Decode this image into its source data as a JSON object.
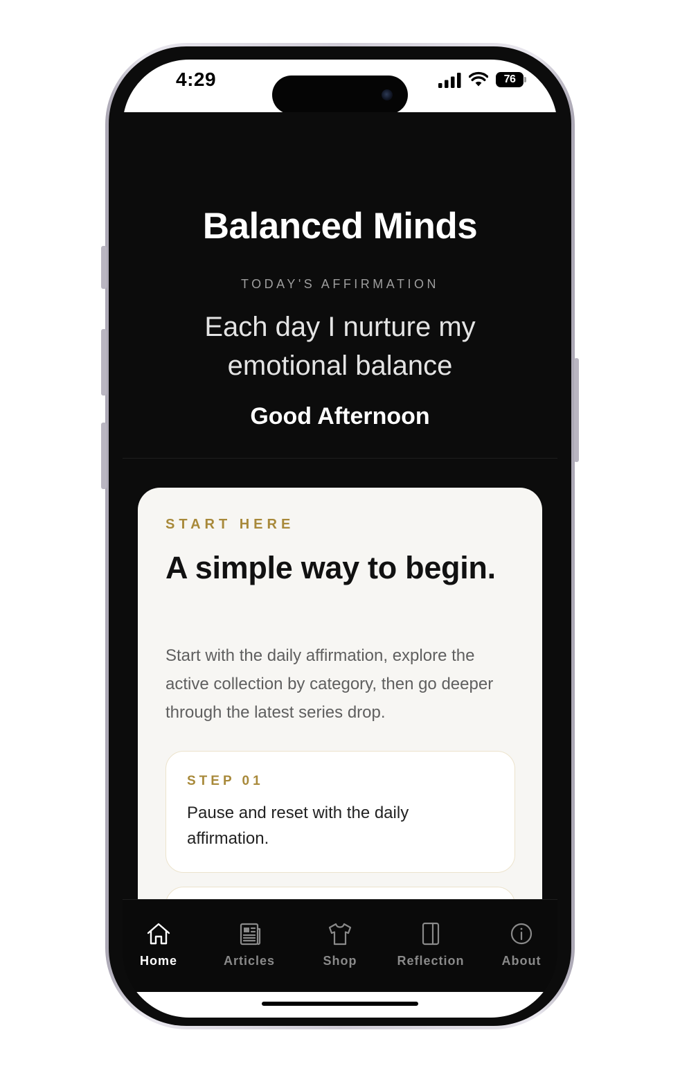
{
  "status_bar": {
    "time": "4:29",
    "battery_level": "76",
    "icons": [
      "signal-icon",
      "wifi-icon",
      "battery-icon"
    ]
  },
  "header": {
    "title": "Balanced Minds",
    "affirmation_label": "TODAY'S AFFIRMATION",
    "affirmation_text": "Each day I nurture my emotional balance",
    "greeting": "Good Afternoon"
  },
  "start_card": {
    "eyebrow": "START HERE",
    "heading": "A simple way to begin.",
    "body": "Start with the daily affirmation, explore the active collection by category, then go deeper through the latest series drop.",
    "steps": [
      {
        "label": "STEP 01",
        "text": "Pause and reset with the daily affirmation."
      }
    ]
  },
  "tab_bar": {
    "active": "Home",
    "tabs": [
      {
        "label": "Home",
        "icon": "home-icon"
      },
      {
        "label": "Articles",
        "icon": "newspaper-icon"
      },
      {
        "label": "Shop",
        "icon": "tshirt-icon"
      },
      {
        "label": "Reflection",
        "icon": "journal-icon"
      },
      {
        "label": "About",
        "icon": "info-icon"
      }
    ]
  },
  "colors": {
    "background": "#0c0c0c",
    "card": "#f7f6f3",
    "accent_gold": "#a8893a",
    "active_tab": "#ffffff",
    "inactive_tab": "#8a8a8a"
  }
}
